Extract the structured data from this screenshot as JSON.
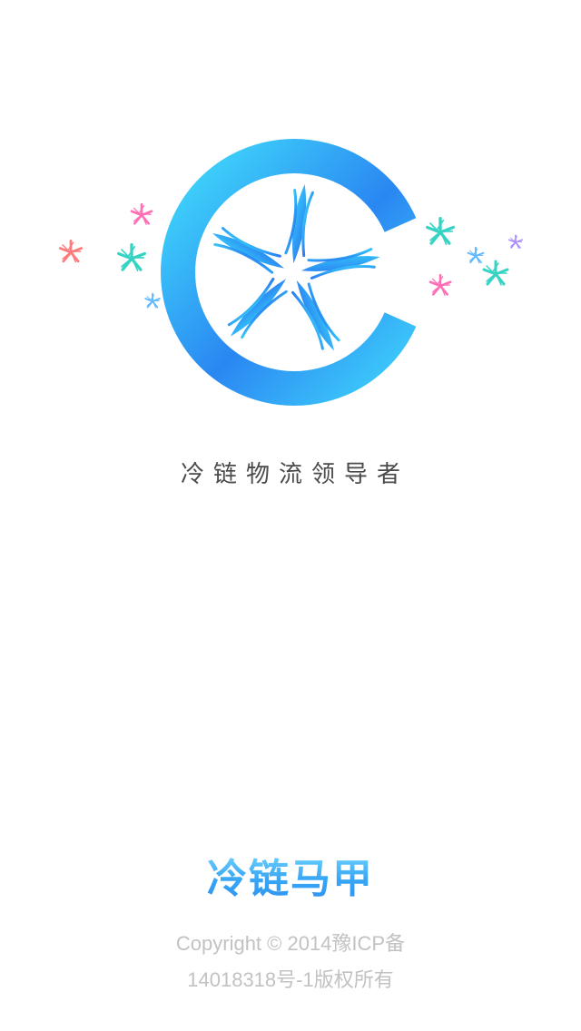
{
  "logo": {
    "name": "cold-chain-snowflake-logo",
    "colors": {
      "ring_start": "#3fd6fb",
      "ring_end": "#2a7ff0",
      "pink": "#ff6fb5",
      "teal": "#36d3c4",
      "red": "#ff7a7a",
      "violet": "#a98cff",
      "sky": "#5fb8ff"
    }
  },
  "tagline": "冷链物流领导者",
  "brand": {
    "name": "冷链马甲"
  },
  "copyright": {
    "line1": "Copyright © 2014豫ICP备",
    "line2": "14018318号-1版权所有"
  }
}
